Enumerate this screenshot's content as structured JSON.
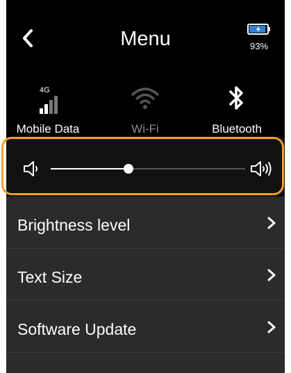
{
  "header": {
    "title": "Menu",
    "battery_percent_label": "93%",
    "battery_level": 0.93
  },
  "quick_settings": [
    {
      "label": "Mobile Data",
      "badge": "4G",
      "icon": "signal-bars-icon",
      "active": true
    },
    {
      "label": "Wi-Fi",
      "icon": "wifi-icon",
      "active": false
    },
    {
      "label": "Bluetooth",
      "icon": "bluetooth-icon",
      "active": true
    }
  ],
  "volume": {
    "level": 0.4,
    "low_icon": "volume-low-icon",
    "high_icon": "volume-high-icon"
  },
  "menu_items": [
    {
      "label": "Brightness level"
    },
    {
      "label": "Text Size"
    },
    {
      "label": "Software Update"
    }
  ],
  "colors": {
    "highlight": "#f0a125",
    "battery": "#2f7fd6",
    "background": "#000000",
    "list_background": "#2b2b2b"
  }
}
